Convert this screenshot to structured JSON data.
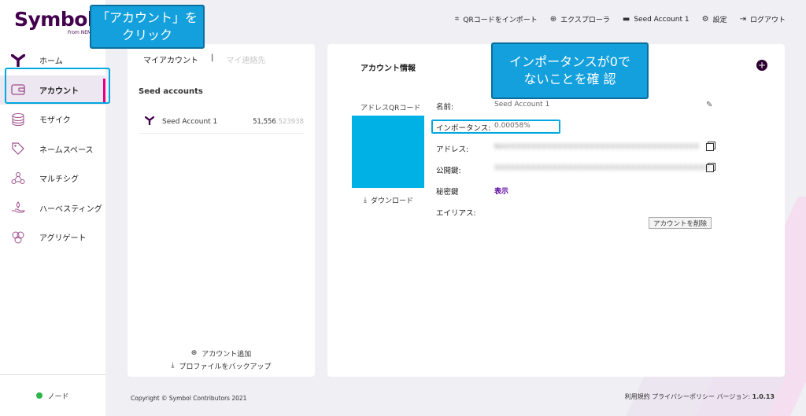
{
  "brand": {
    "name": "Symbol",
    "sub": "From NEM"
  },
  "topbar": {
    "qr_import": "QRコードをインポート",
    "explorer": "エクスプローラ",
    "account": "Seed Account 1",
    "settings": "設定",
    "logout": "ログアウト"
  },
  "sidebar": {
    "items": [
      {
        "label": "ホーム",
        "icon": "symbol-y-icon"
      },
      {
        "label": "アカウント",
        "icon": "wallet-icon"
      },
      {
        "label": "モザイク",
        "icon": "coins-icon"
      },
      {
        "label": "ネームスペース",
        "icon": "tag-icon"
      },
      {
        "label": "マルチシグ",
        "icon": "multisig-icon"
      },
      {
        "label": "ハーベスティング",
        "icon": "harvest-hand-icon"
      },
      {
        "label": "アグリゲート",
        "icon": "aggregate-icon"
      }
    ],
    "node": "ノード"
  },
  "accounts_panel": {
    "tab_my_accounts": "マイアカウント",
    "tab_contacts": "マイ連絡先",
    "seed_heading": "Seed accounts",
    "accounts": [
      {
        "name": "Seed Account 1",
        "balance_int": "51,556",
        "balance_dec": ".523938"
      }
    ],
    "add_account": "アカウント追加",
    "backup_profile": "プロファイルをバックアップ"
  },
  "account_info": {
    "title": "アカウント情報",
    "qr_label": "アドレスQRコード",
    "download": "ダウンロード",
    "name_label": "名前:",
    "name_value": "Seed Account 1",
    "importance_label": "インポータンス:",
    "importance_value": "0.00058%",
    "address_label": "アドレス:",
    "address_value": "NAXXXXXXXXXXXXXXXXXXXXXXXXXXXXXXXXXXXXX",
    "pubkey_label": "公開鍵:",
    "pubkey_value": "XXXXXXXXXXXXXXXXXXXXXXXXXXXXXXXXXXXXXXXXX...",
    "privkey_label": "秘密鍵",
    "privkey_show": "表示",
    "alias_label": "エイリアス:",
    "delete_button": "アカウントを削除"
  },
  "callouts": {
    "click_account_line1": "「アカウント」を",
    "click_account_line2": "クリック",
    "importance_line1": "インポータンスが0で",
    "importance_line2": "ないことを確 認"
  },
  "footer": {
    "copyright": "Copyright © Symbol Contributors 2021",
    "terms": "利用規約",
    "privacy": "プライバシーポリシー",
    "version_label": "バージョン:",
    "version": "1.0.13"
  },
  "colors": {
    "brand": "#44004e",
    "accent": "#e5007d",
    "callout": "#14a0dc",
    "node_ok": "#2fb44a"
  }
}
